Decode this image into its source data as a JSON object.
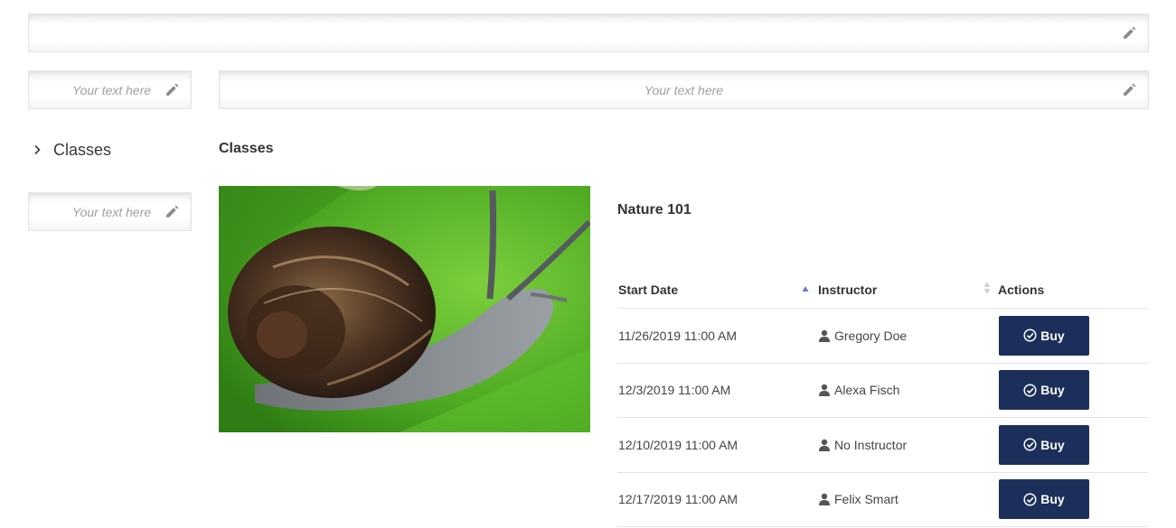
{
  "header": {
    "editable_placeholder": ""
  },
  "left_editable_top": {
    "placeholder": "Your text here"
  },
  "main_editable": {
    "placeholder": "Your text here"
  },
  "left_editable_bottom": {
    "placeholder": "Your text here"
  },
  "sidebar": {
    "classes_label": "Classes",
    "icons": {
      "expand": "chevron-right-icon"
    }
  },
  "main": {
    "section_title": "Classes",
    "image": {
      "description_icon": "snail-photo"
    },
    "class_title": "Nature 101",
    "table": {
      "headers": {
        "start_date": "Start Date",
        "instructor": "Instructor",
        "actions": "Actions"
      },
      "sort": {
        "start_date": "ascending",
        "instructor": "none"
      },
      "sort_active_color": "#6f78c8",
      "rows": [
        {
          "start_date": "11/26/2019 11:00 AM",
          "instructor": "Gregory Doe",
          "action_label": "Buy"
        },
        {
          "start_date": "12/3/2019 11:00 AM",
          "instructor": "Alexa Fisch",
          "action_label": "Buy"
        },
        {
          "start_date": "12/10/2019 11:00 AM",
          "instructor": "No Instructor",
          "action_label": "Buy"
        },
        {
          "start_date": "12/17/2019 11:00 AM",
          "instructor": "Felix Smart",
          "action_label": "Buy"
        }
      ]
    }
  },
  "colors": {
    "button_bg": "#1b2f5a",
    "button_text": "#ffffff",
    "pencil": "#8a8a8a"
  }
}
